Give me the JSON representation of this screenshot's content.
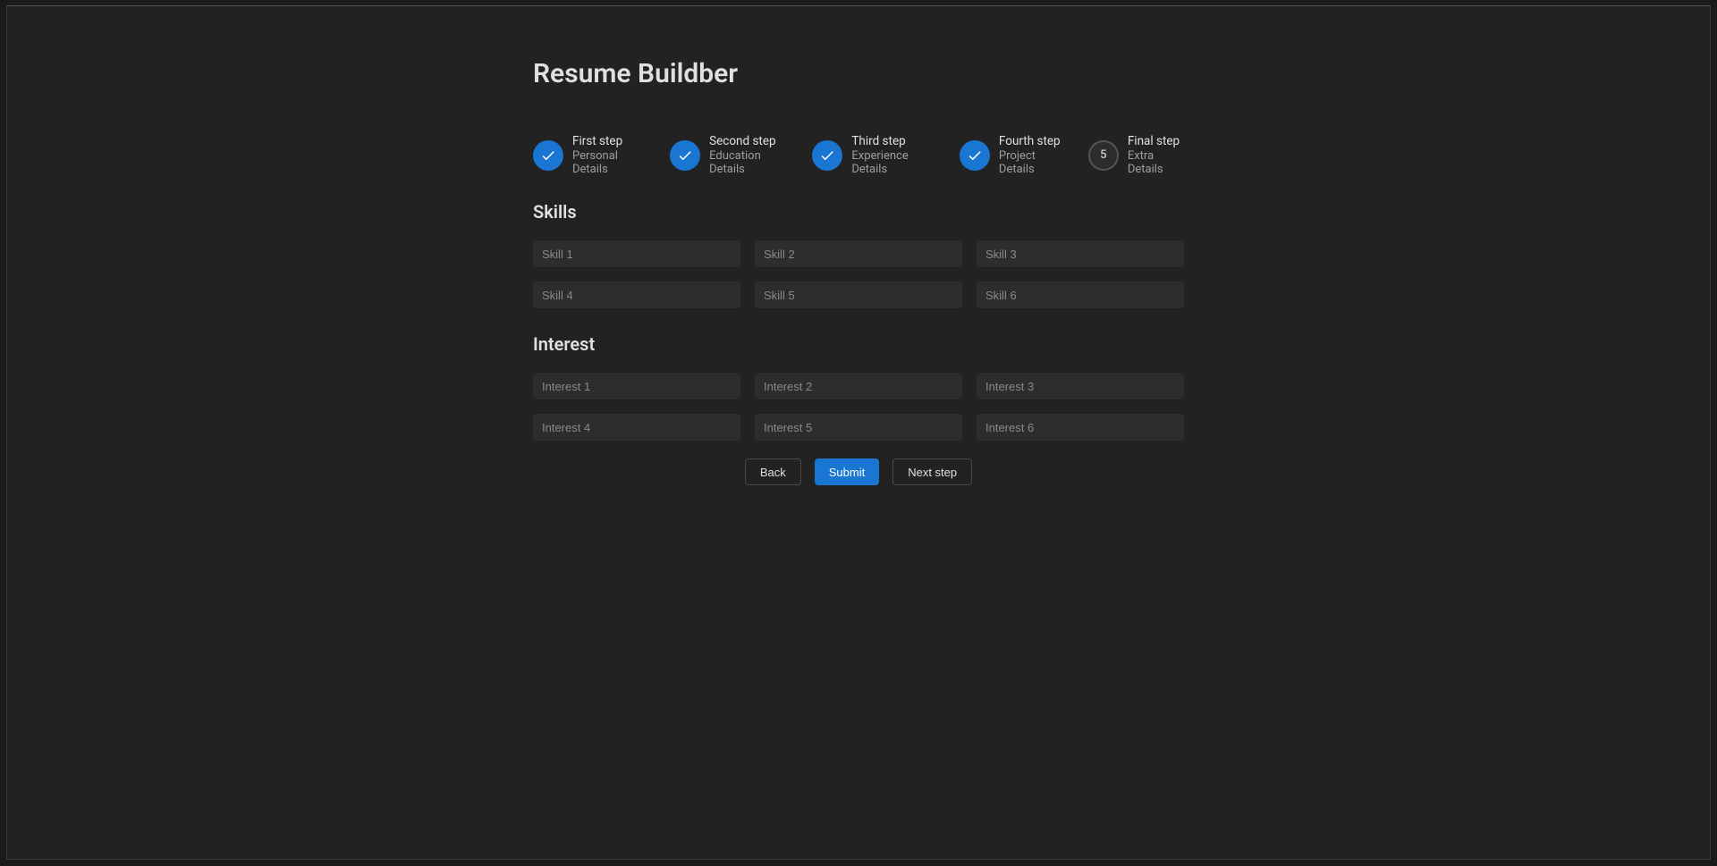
{
  "page_title": "Resume Buildber",
  "stepper": {
    "steps": [
      {
        "title": "First step",
        "subtitle": "Personal Details",
        "state": "completed"
      },
      {
        "title": "Second step",
        "subtitle": "Education Details",
        "state": "completed"
      },
      {
        "title": "Third step",
        "subtitle": "Experience Details",
        "state": "completed"
      },
      {
        "title": "Fourth step",
        "subtitle": "Project Details",
        "state": "completed"
      },
      {
        "title": "Final step",
        "subtitle": "Extra Details",
        "state": "current",
        "number": "5"
      }
    ]
  },
  "sections": {
    "skills": {
      "title": "Skills",
      "placeholders": [
        "Skill 1",
        "Skill 2",
        "Skill 3",
        "Skill 4",
        "Skill 5",
        "Skill 6"
      ]
    },
    "interest": {
      "title": "Interest",
      "placeholders": [
        "Interest 1",
        "Interest 2",
        "Interest 3",
        "Interest 4",
        "Interest 5",
        "Interest 6"
      ]
    }
  },
  "buttons": {
    "back": "Back",
    "submit": "Submit",
    "next": "Next step"
  }
}
